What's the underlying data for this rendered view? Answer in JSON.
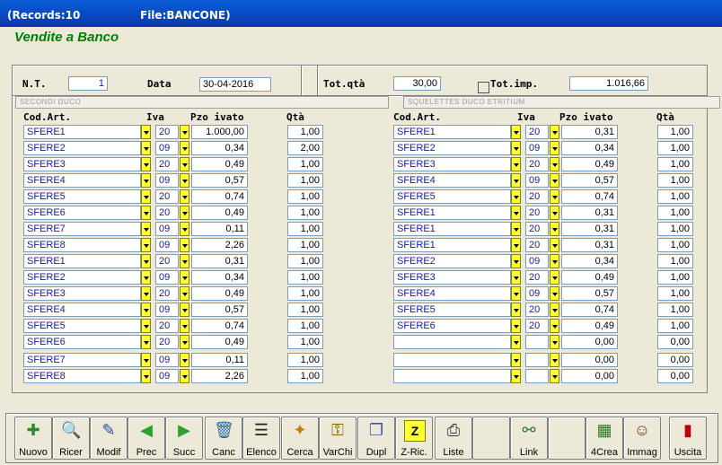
{
  "titlebar": {
    "records": "(Records:10",
    "file": "File:BANCONE)"
  },
  "app_title": "Vendite a Banco",
  "header": {
    "nt_label": "N.T.",
    "nt_value": "1",
    "data_label": "Data",
    "data_value": "30-04-2016",
    "totqta_label": "Tot.qtà",
    "totqta_value": "30,00",
    "totimp_label": "Tot.imp.",
    "totimp_value": "1.016,66"
  },
  "desc_left": "SECONDI DUCO",
  "desc_right": "SQUELETTES DUCO ETRITIUM",
  "columns": {
    "cod": "Cod.Art.",
    "iva": "Iva",
    "pzo": "Pzo ivato",
    "qta": "Qtà"
  },
  "left_rows": [
    {
      "cod": "SFERE1",
      "iva": "20",
      "pzo": "1.000,00",
      "qta": "1,00"
    },
    {
      "cod": "SFERE2",
      "iva": "09",
      "pzo": "0,34",
      "qta": "2,00"
    },
    {
      "cod": "SFERE3",
      "iva": "20",
      "pzo": "0,49",
      "qta": "1,00"
    },
    {
      "cod": "SFERE4",
      "iva": "09",
      "pzo": "0,57",
      "qta": "1,00"
    },
    {
      "cod": "SFERE5",
      "iva": "20",
      "pzo": "0,74",
      "qta": "1,00"
    },
    {
      "cod": "SFERE6",
      "iva": "20",
      "pzo": "0,49",
      "qta": "1,00"
    },
    {
      "cod": "SFERE7",
      "iva": "09",
      "pzo": "0,11",
      "qta": "1,00"
    },
    {
      "cod": "SFERE8",
      "iva": "09",
      "pzo": "2,26",
      "qta": "1,00"
    },
    {
      "cod": "SFERE1",
      "iva": "20",
      "pzo": "0,31",
      "qta": "1,00"
    },
    {
      "cod": "SFERE2",
      "iva": "09",
      "pzo": "0,34",
      "qta": "1,00"
    },
    {
      "cod": "SFERE3",
      "iva": "20",
      "pzo": "0,49",
      "qta": "1,00"
    },
    {
      "cod": "SFERE4",
      "iva": "09",
      "pzo": "0,57",
      "qta": "1,00"
    },
    {
      "cod": "SFERE5",
      "iva": "20",
      "pzo": "0,74",
      "qta": "1,00"
    },
    {
      "cod": "SFERE6",
      "iva": "20",
      "pzo": "0,49",
      "qta": "1,00"
    },
    {
      "cod": "SFERE7",
      "iva": "09",
      "pzo": "0,11",
      "qta": "1,00"
    },
    {
      "cod": "SFERE8",
      "iva": "09",
      "pzo": "2,26",
      "qta": "1,00"
    }
  ],
  "right_rows": [
    {
      "cod": "SFERE1",
      "iva": "20",
      "pzo": "0,31",
      "qta": "1,00"
    },
    {
      "cod": "SFERE2",
      "iva": "09",
      "pzo": "0,34",
      "qta": "1,00"
    },
    {
      "cod": "SFERE3",
      "iva": "20",
      "pzo": "0,49",
      "qta": "1,00"
    },
    {
      "cod": "SFERE4",
      "iva": "09",
      "pzo": "0,57",
      "qta": "1,00"
    },
    {
      "cod": "SFERE5",
      "iva": "20",
      "pzo": "0,74",
      "qta": "1,00"
    },
    {
      "cod": "SFERE1",
      "iva": "20",
      "pzo": "0,31",
      "qta": "1,00"
    },
    {
      "cod": "SFERE1",
      "iva": "20",
      "pzo": "0,31",
      "qta": "1,00"
    },
    {
      "cod": "SFERE1",
      "iva": "20",
      "pzo": "0,31",
      "qta": "1,00"
    },
    {
      "cod": "SFERE2",
      "iva": "09",
      "pzo": "0,34",
      "qta": "1,00"
    },
    {
      "cod": "SFERE3",
      "iva": "20",
      "pzo": "0,49",
      "qta": "1,00"
    },
    {
      "cod": "SFERE4",
      "iva": "09",
      "pzo": "0,57",
      "qta": "1,00"
    },
    {
      "cod": "SFERE5",
      "iva": "20",
      "pzo": "0,74",
      "qta": "1,00"
    },
    {
      "cod": "SFERE6",
      "iva": "20",
      "pzo": "0,49",
      "qta": "1,00"
    },
    {
      "cod": "",
      "iva": "",
      "pzo": "0,00",
      "qta": "0,00"
    },
    {
      "cod": "",
      "iva": "",
      "pzo": "0,00",
      "qta": "0,00"
    },
    {
      "cod": "",
      "iva": "",
      "pzo": "0,00",
      "qta": "0,00"
    }
  ],
  "toolbar": [
    {
      "name": "nuovo",
      "label": "Nuovo",
      "icon": "new-document-icon",
      "glyph": "✚",
      "color": "#2e8b2e"
    },
    {
      "name": "ricer",
      "label": "Ricer",
      "icon": "search-icon",
      "glyph": "🔍",
      "color": "#333"
    },
    {
      "name": "modif",
      "label": "Modif",
      "icon": "edit-icon",
      "glyph": "✎",
      "color": "#2a4c9a"
    },
    {
      "name": "prec",
      "label": "Prec",
      "icon": "arrow-left-icon",
      "glyph": "◀",
      "color": "#2ea02e"
    },
    {
      "name": "succ",
      "label": "Succ",
      "icon": "arrow-right-icon",
      "glyph": "▶",
      "color": "#2ea02e"
    },
    {
      "name": "canc",
      "label": "Canc",
      "icon": "trash-icon",
      "glyph": "🗑",
      "color": "#2a6aa0"
    },
    {
      "name": "elenco",
      "label": "Elenco",
      "icon": "list-icon",
      "glyph": "☰",
      "color": "#222"
    },
    {
      "name": "cerca",
      "label": "Cerca",
      "icon": "flashlight-icon",
      "glyph": "✦",
      "color": "#c08000"
    },
    {
      "name": "varchi",
      "label": "VarChi",
      "icon": "keys-icon",
      "glyph": "⚿",
      "color": "#806000"
    },
    {
      "name": "dupl",
      "label": "Dupl",
      "icon": "copy-icon",
      "glyph": "❐",
      "color": "#3a5aa0"
    },
    {
      "name": "zric",
      "label": "Z-Ric.",
      "icon": "z-search-icon",
      "glyph": "Z",
      "color": "#000",
      "yellow": true
    },
    {
      "name": "liste",
      "label": "Liste",
      "icon": "printer-icon",
      "glyph": "⎙",
      "color": "#333"
    },
    {
      "name": "blank1",
      "label": "",
      "icon": "",
      "glyph": "",
      "color": "#000"
    },
    {
      "name": "link",
      "label": "Link",
      "icon": "tree-link-icon",
      "glyph": "⚯",
      "color": "#2a7a2a"
    },
    {
      "name": "blank2",
      "label": "",
      "icon": "",
      "glyph": "",
      "color": "#000"
    },
    {
      "name": "4crea",
      "label": "4Crea",
      "icon": "image-edit-icon",
      "glyph": "▦",
      "color": "#2a7a2a"
    },
    {
      "name": "immag",
      "label": "Immag",
      "icon": "id-card-icon",
      "glyph": "☺",
      "color": "#7a3a1a"
    },
    {
      "name": "uscita",
      "label": "Uscita",
      "icon": "exit-door-icon",
      "glyph": "▮",
      "color": "#c00000"
    }
  ]
}
